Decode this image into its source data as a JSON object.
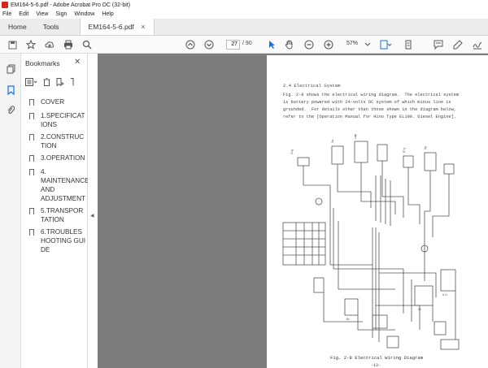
{
  "window": {
    "title": "EM164-5-6.pdf - Adobe Acrobat Pro DC (32-bit)",
    "brand_color": "#d9261c"
  },
  "menu": [
    "File",
    "Edit",
    "View",
    "Sign",
    "Window",
    "Help"
  ],
  "tabs": {
    "home": "Home",
    "tools": "Tools",
    "document": "EM164-5-6.pdf",
    "close": "×"
  },
  "toolbar": {
    "current_page": "27",
    "total_pages": "/ 90",
    "zoom": "57%"
  },
  "bookmarks": {
    "title": "Bookmarks",
    "close": "✕",
    "items": [
      {
        "label": "COVER"
      },
      {
        "label": "1.SPECIFICATIONS"
      },
      {
        "label": "2.CONSTRUCTION"
      },
      {
        "label": "3.OPERATION"
      },
      {
        "label": "4. MAINTENANCE AND ADJUSTMENT"
      },
      {
        "label": "5.TRANSPORTATION"
      },
      {
        "label": "6.TROUBLESHOOTING GUIDE"
      }
    ]
  },
  "page": {
    "heading": "2.4 Electrical System",
    "para1": "Fig. 2-8 shows the electrical wiring diagram.  The electrical system",
    "para2": "is battery powered with 24-volts DC system of which minus line is",
    "para3": "grounded.  For details other than those shown in the diagram below,",
    "para4": "refer to the [Operation Manual for Hino Type EL100. Diesel Engine].",
    "caption": "Fig. 2-8  Electrical Wiring Diagram",
    "page_number": "-13-"
  }
}
